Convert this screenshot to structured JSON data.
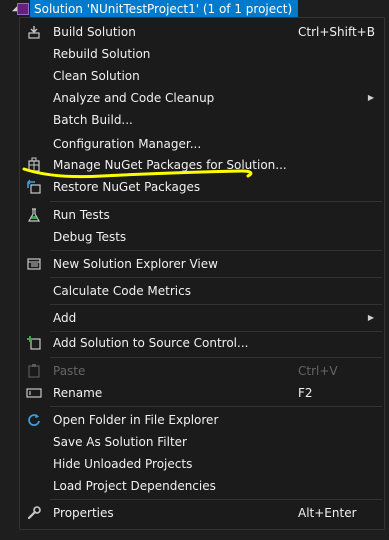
{
  "tree": {
    "solution_label": "Solution 'NUnitTestProject1' (1 of 1 project)",
    "expander_icon": "triangle-down"
  },
  "menu": {
    "items": [
      {
        "label": "Build Solution",
        "shortcut": "Ctrl+Shift+B",
        "icon": "build-icon"
      },
      {
        "label": "Rebuild Solution"
      },
      {
        "label": "Clean Solution"
      },
      {
        "label": "Analyze and Code Cleanup",
        "submenu": true
      },
      {
        "label": "Batch Build..."
      },
      {
        "label": "Configuration Manager..."
      },
      {
        "label": "Manage NuGet Packages for Solution...",
        "icon": "nuget-icon"
      },
      {
        "label": "Restore NuGet Packages",
        "icon": "restore-icon"
      },
      {
        "label": "Run Tests",
        "icon": "flask-icon"
      },
      {
        "label": "Debug Tests"
      },
      {
        "label": "New Solution Explorer View",
        "icon": "new-view-icon"
      },
      {
        "label": "Calculate Code Metrics"
      },
      {
        "label": "Add",
        "submenu": true
      },
      {
        "label": "Add Solution to Source Control...",
        "icon": "source-control-icon"
      },
      {
        "label": "Paste",
        "shortcut": "Ctrl+V",
        "icon": "paste-icon",
        "disabled": true
      },
      {
        "label": "Rename",
        "shortcut": "F2",
        "icon": "rename-icon"
      },
      {
        "label": "Open Folder in File Explorer",
        "icon": "refresh-folder-icon"
      },
      {
        "label": "Save As Solution Filter"
      },
      {
        "label": "Hide Unloaded Projects"
      },
      {
        "label": "Load Project Dependencies"
      },
      {
        "label": "Properties",
        "shortcut": "Alt+Enter",
        "icon": "wrench-icon"
      }
    ]
  },
  "colors": {
    "selection": "#007acc",
    "menu_background": "#1b1b1c",
    "annotation": "#ffff00"
  }
}
